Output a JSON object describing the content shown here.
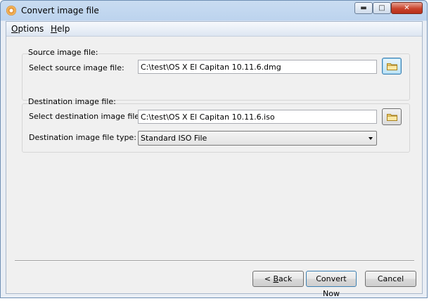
{
  "window": {
    "title": "Convert image file",
    "icon": "disc-icon"
  },
  "menubar": {
    "items": [
      {
        "label": "Options",
        "accel": "O",
        "rest": "ptions"
      },
      {
        "label": "Help",
        "accel": "H",
        "rest": "elp"
      }
    ]
  },
  "source": {
    "group_title": "Source image file:",
    "file_label": "Select source image file:",
    "file_value": "C:\\test\\OS X El Capitan 10.11.6.dmg"
  },
  "destination": {
    "group_title": "Destination image file:",
    "file_label": "Select destination image file:",
    "file_value": "C:\\test\\OS X El Capitan 10.11.6.iso",
    "type_label": "Destination image file type:",
    "type_value": "Standard ISO File"
  },
  "buttons": {
    "back": {
      "accel": "< ",
      "u": "B",
      "rest": "ack"
    },
    "convert": "Convert Now",
    "cancel": "Cancel"
  },
  "colors": {
    "titlebar": "#bcd3ee",
    "close": "#c9432c",
    "client": "#f0f0f0",
    "focus": "#3c7fb1"
  }
}
